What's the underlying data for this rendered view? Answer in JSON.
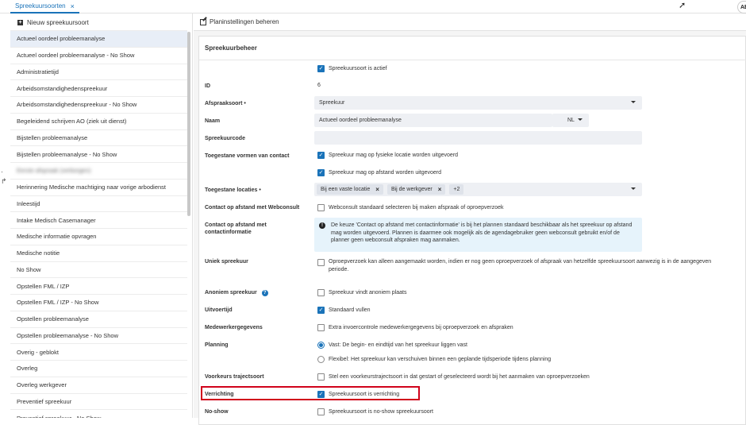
{
  "tab": {
    "label": "Spreekuursoorten",
    "close": "×"
  },
  "avatar": "AE",
  "left": {
    "new_label": "Nieuw spreekuursoort",
    "items": [
      "Actueel oordeel probleemanalyse",
      "Actueel oordeel probleemanalyse - No Show",
      "Administratietijd",
      "Arbeidsomstandighedenspreekuur",
      "Arbeidsomstandighedenspreekuur - No Show",
      "Begeleidend schrijven AO (ziek uit dienst)",
      "Bijstellen probleemanalyse",
      "Bijstellen probleemanalyse - No Show",
      "Eerste afspraak (verborgen)",
      "Herinnering Medische machtiging naar vorige arbodienst",
      "Inleestijd",
      "Intake Medisch Casemanager",
      "Medische informatie opvragen",
      "Medische notitie",
      "No Show",
      "Opstellen FML / IZP",
      "Opstellen FML / IZP - No Show",
      "Opstellen probleemanalyse",
      "Opstellen probleemanalyse - No Show",
      "Overig - geblokt",
      "Overleg",
      "Overleg werkgever",
      "Preventief spreekuur",
      "Preventief spreekuur - No Show"
    ]
  },
  "right": {
    "toolbar_label": "Planinstellingen beheren",
    "card_title": "Spreekuurbeheer",
    "active_label": "Spreekuursoort is actief",
    "id_label": "ID",
    "id_value": "6",
    "afspraaksoort_label": "Afspraaksoort •",
    "afspraaksoort_value": "Spreekuur",
    "naam_label": "Naam",
    "naam_value": "Actueel oordeel probleemanalyse",
    "naam_lang": "NL",
    "code_label": "Spreekuurcode",
    "vormen_label": "Toegestane vormen van contact",
    "vormen_opt1": "Spreekuur mag op fysieke locatie worden uitgevoerd",
    "vormen_opt2": "Spreekuur mag op afstand worden uitgevoerd",
    "locaties_label": "Toegestane locaties •",
    "locatie_chip1": "Bij een vaste locatie",
    "locatie_chip2": "Bij de werkgever",
    "locatie_more": "+2",
    "webconsult_label": "Contact op afstand met Webconsult",
    "webconsult_opt": "Webconsult standaard selecteren bij maken afspraak of oproepverzoek",
    "contactinfo_label": "Contact op afstand met contactinformatie",
    "contactinfo_text": "De keuze 'Contact op afstand met contactinformatie' is bij het plannen standaard beschikbaar als het spreekuur op afstand mag worden uitgevoerd. Plannen is daarmee ook mogelijk als de agendagebruiker geen webconsult gebruikt en/of de planner geen webconsult afspraken mag aanmaken.",
    "uniek_label": "Uniek spreekuur",
    "uniek_opt": "Oproepverzoek kan alleen aangemaakt worden, indien er nog geen oproepverzoek of afspraak van hetzelfde spreekuursoort aanwezig is in de aangegeven periode.",
    "anoniem_label": "Anoniem spreekuur",
    "anoniem_help": "?",
    "anoniem_opt": "Spreekuur vindt anoniem plaats",
    "uitvoertijd_label": "Uitvoertijd",
    "uitvoertijd_opt": "Standaard vullen",
    "medewerker_label": "Medewerkergegevens",
    "medewerker_opt": "Extra invoercontrole medewerkergegevens bij oproepverzoek en afspraken",
    "planning_label": "Planning",
    "planning_opt1": "Vast: De begin- en eindtijd van het spreekuur liggen vast",
    "planning_opt2": "Flexibel: Het spreekuur kan verschuiven binnen een geplande tijdsperiode tijdens planning",
    "traject_label": "Voorkeurs trajectsoort",
    "traject_opt": "Stel een voorkeurstrajectsoort in dat gestart of geselecteerd wordt bij het aanmaken van oproepverzoeken",
    "verrichting_label": "Verrichting",
    "verrichting_opt": "Spreekuursoort is verrichting",
    "noshow_label": "No-show",
    "noshow_opt": "Spreekuursoort is no-show spreekuursoort"
  }
}
